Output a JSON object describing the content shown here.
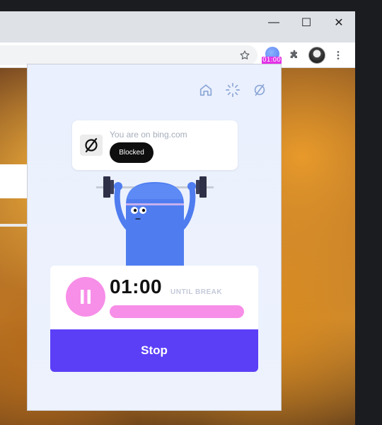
{
  "window": {
    "controls": [
      {
        "name": "minimize",
        "glyph": "—"
      },
      {
        "name": "maximize",
        "glyph": "☐"
      },
      {
        "name": "close",
        "glyph": "✕"
      }
    ]
  },
  "toolbar": {
    "extension_badge": "01:00",
    "icons": [
      "star-icon",
      "puzzle-icon",
      "avatar",
      "more-icon"
    ]
  },
  "popup": {
    "nav": [
      "home-icon",
      "loading-icon",
      "block-icon"
    ],
    "site": {
      "text": "You are on bing.com",
      "status": "Blocked"
    },
    "timer": {
      "value": "01:00",
      "label": "UNTIL BREAK",
      "progress": 1.0
    },
    "stop_label": "Stop"
  },
  "colors": {
    "accent": "#5b3ff7",
    "pink": "#f78ee8",
    "pink_light": "#fdd9f7",
    "mascot": "#4f7df0",
    "popup_bg": "#eaf0fd"
  }
}
